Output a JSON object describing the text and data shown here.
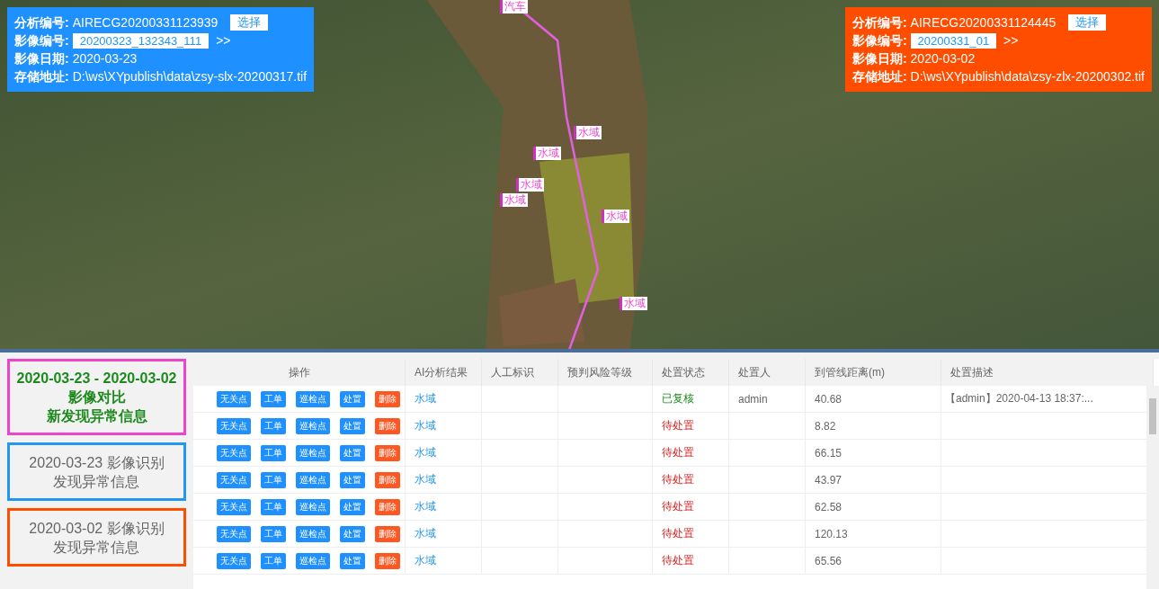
{
  "info_panels": [
    {
      "color": "#1e90ff",
      "analysis_label": "分析编号:",
      "analysis_id": "AIRECG20200331123939",
      "select_button": "选择",
      "image_label": "影像编号:",
      "image_id": "20200323_132343_111",
      "next_link": ">>",
      "date_label": "影像日期:",
      "date": "2020-03-23",
      "path_label": "存储地址:",
      "path": "D:\\ws\\XYpublish\\data\\zsy-slx-20200317.tif"
    },
    {
      "color": "#ff4d00",
      "analysis_label": "分析编号:",
      "analysis_id": "AIRECG20200331124445",
      "select_button": "选择",
      "image_label": "影像编号:",
      "image_id": "20200331_01",
      "next_link": ">>",
      "date_label": "影像日期:",
      "date": "2020-03-02",
      "path_label": "存储地址:",
      "path": "D:\\ws\\XYpublish\\data\\zsy-zlx-20200302.tif"
    }
  ],
  "map_markers": [
    {
      "label": "汽车"
    },
    {
      "label": "水域"
    },
    {
      "label": "水域"
    },
    {
      "label": "水域"
    },
    {
      "label": "水域"
    },
    {
      "label": "水域"
    },
    {
      "label": "水域"
    }
  ],
  "side_cards": [
    {
      "selected": true,
      "color": "#ee44cc",
      "lines": [
        "2020-03-23 - 2020-03-02 影像对比",
        "新发现异常信息"
      ]
    },
    {
      "selected": false,
      "color": "#2196f3",
      "lines": [
        "2020-03-23 影像识别",
        "发现异常信息"
      ]
    },
    {
      "selected": false,
      "color": "#ff4d00",
      "lines": [
        "2020-03-02 影像识别",
        "发现异常信息"
      ]
    }
  ],
  "table": {
    "columns": [
      "操作",
      "AI分析结果",
      "人工标识",
      "预判风险等级",
      "处置状态",
      "处置人",
      "到管线距离(m)",
      "处置描述"
    ],
    "rows": [
      {
        "actions": [
          {
            "label": "无关点",
            "kind": "normal"
          },
          {
            "label": "工单",
            "kind": "normal"
          },
          {
            "label": "巡检点",
            "kind": "normal"
          },
          {
            "label": "处置",
            "kind": "normal"
          },
          {
            "label": "删除",
            "kind": "danger"
          }
        ],
        "ai_result": "水域",
        "status": "已复核",
        "kind": "reviewed",
        "handler": "admin",
        "distance": "40.68",
        "description": "【admin】2020-04-13 18:37:..."
      },
      {
        "actions": [
          {
            "label": "无关点",
            "kind": "normal"
          },
          {
            "label": "工单",
            "kind": "normal"
          },
          {
            "label": "巡检点",
            "kind": "normal"
          },
          {
            "label": "处置",
            "kind": "normal"
          },
          {
            "label": "删除",
            "kind": "danger"
          }
        ],
        "ai_result": "水域",
        "status": "待处置",
        "kind": "pending",
        "distance": "8.82"
      },
      {
        "actions": [
          {
            "label": "无关点",
            "kind": "normal"
          },
          {
            "label": "工单",
            "kind": "normal"
          },
          {
            "label": "巡检点",
            "kind": "normal"
          },
          {
            "label": "处置",
            "kind": "normal"
          },
          {
            "label": "删除",
            "kind": "danger"
          }
        ],
        "ai_result": "水域",
        "status": "待处置",
        "kind": "pending",
        "distance": "66.15"
      },
      {
        "actions": [
          {
            "label": "无关点",
            "kind": "normal"
          },
          {
            "label": "工单",
            "kind": "normal"
          },
          {
            "label": "巡检点",
            "kind": "normal"
          },
          {
            "label": "处置",
            "kind": "normal"
          },
          {
            "label": "删除",
            "kind": "danger"
          }
        ],
        "ai_result": "水域",
        "status": "待处置",
        "kind": "pending",
        "distance": "43.97"
      },
      {
        "actions": [
          {
            "label": "无关点",
            "kind": "normal"
          },
          {
            "label": "工单",
            "kind": "normal"
          },
          {
            "label": "巡检点",
            "kind": "normal"
          },
          {
            "label": "处置",
            "kind": "normal"
          },
          {
            "label": "删除",
            "kind": "danger"
          }
        ],
        "ai_result": "水域",
        "status": "待处置",
        "kind": "pending",
        "distance": "62.58"
      },
      {
        "actions": [
          {
            "label": "无关点",
            "kind": "normal"
          },
          {
            "label": "工单",
            "kind": "normal"
          },
          {
            "label": "巡检点",
            "kind": "normal"
          },
          {
            "label": "处置",
            "kind": "normal"
          },
          {
            "label": "删除",
            "kind": "danger"
          }
        ],
        "ai_result": "水域",
        "status": "待处置",
        "kind": "pending",
        "distance": "120.13"
      },
      {
        "actions": [
          {
            "label": "无关点",
            "kind": "normal"
          },
          {
            "label": "工单",
            "kind": "normal"
          },
          {
            "label": "巡检点",
            "kind": "normal"
          },
          {
            "label": "处置",
            "kind": "normal"
          },
          {
            "label": "删除",
            "kind": "danger"
          }
        ],
        "ai_result": "水域",
        "status": "待处置",
        "kind": "pending",
        "distance": "65.56"
      }
    ]
  }
}
